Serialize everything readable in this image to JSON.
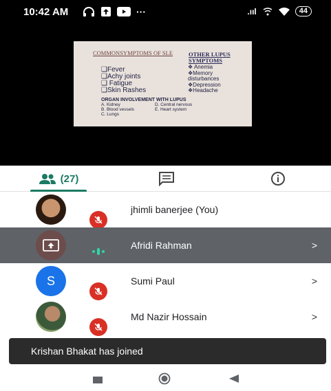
{
  "status_bar": {
    "time": "10:42 AM",
    "dots": "···",
    "battery": "44",
    "signal": ".ııl"
  },
  "slide": {
    "heading_left": "COMMONSYMPTOMS OF SLE",
    "heading_right": "OTHER LUPUS SYMPTOMS",
    "common_symptoms": [
      "❑Fever",
      "❑Achy joints",
      "❑ Fatigue",
      "❑Skin Rashes"
    ],
    "other_symptoms": [
      "❖ Anemia",
      "❖Memory",
      "disturbances",
      "❖Depression",
      "❖Headache"
    ],
    "organ_heading": "ORGAN INVOLVEMENT WITH LUPUS",
    "organs": [
      "A. Kidney",
      "D. Central nervous",
      "B. Blood vessels",
      "E. Heart system",
      "C. Lungs",
      ""
    ]
  },
  "tabs": {
    "people_count": "(27)",
    "icons": [
      "people-icon",
      "chat-icon",
      "info-icon"
    ]
  },
  "participants": [
    {
      "name": "jhimli banerjee (You)",
      "avatar": "photo",
      "muted": true,
      "chevron": ""
    },
    {
      "name": "Afridi Rahman",
      "avatar": "screen-share",
      "speaking": true,
      "chevron": ">"
    },
    {
      "name": "Sumi Paul",
      "avatar": "initial",
      "initial": "S",
      "muted": true,
      "chevron": ">"
    },
    {
      "name": "Md Nazir Hossain",
      "avatar": "photo",
      "muted": true,
      "chevron": ">"
    }
  ],
  "toast": {
    "message": "Krishan Bhakat has joined"
  },
  "colors": {
    "accent": "#1a7a63",
    "mute_red": "#d93025",
    "avatar_blue": "#1a73e8",
    "highlight_row": "#5f6368"
  }
}
